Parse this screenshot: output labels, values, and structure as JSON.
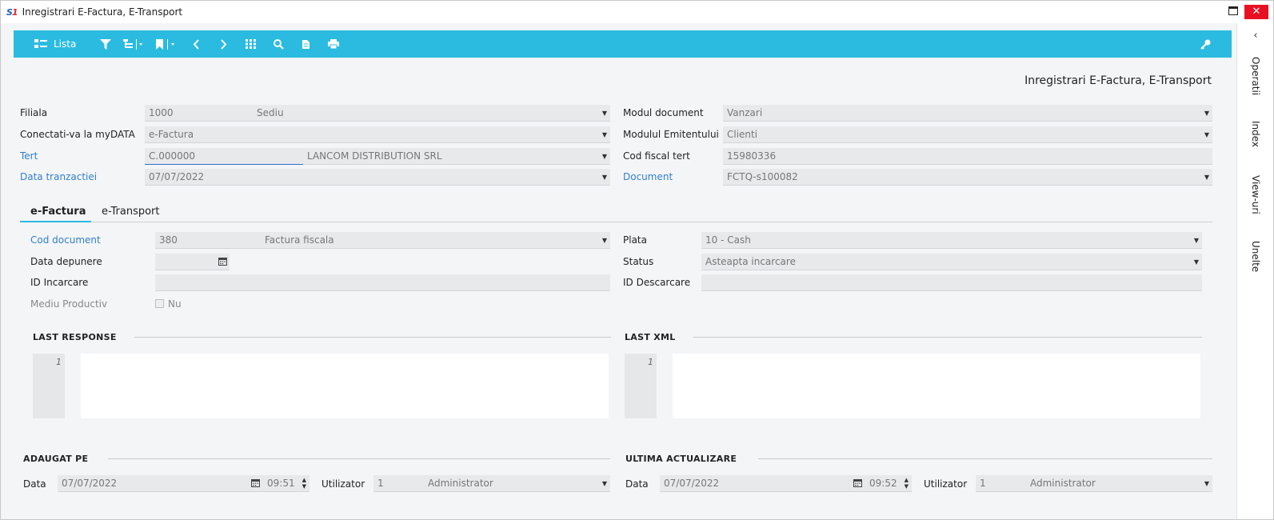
{
  "window": {
    "title": "Inregistrari E-Factura, E-Transport",
    "logo_text": "S",
    "logo_one": "1",
    "maximize_icon": "maximize-icon",
    "close_symbol": "✕"
  },
  "toolbar": {
    "lista_label": "Lista",
    "icons": [
      "list-icon",
      "filter-icon",
      "tree-icon",
      "bookmark-icon",
      "prev-icon",
      "next-icon",
      "grid-icon",
      "zoom-icon",
      "attach-icon",
      "print-icon",
      "key-icon"
    ]
  },
  "sidebar": {
    "collapse": "‹",
    "tabs": [
      "Operatii",
      "Index",
      "View-uri",
      "Unelte"
    ]
  },
  "page_title": "Inregistrari E-Factura, E-Transport",
  "header_left": {
    "filiala": {
      "label": "Filiala",
      "code": "1000",
      "name": "Sediu"
    },
    "conectati": {
      "label": "Conectati-va la myDATA",
      "value": "e-Factura"
    },
    "tert": {
      "label": "Tert",
      "code": "C.000000",
      "name": "LANCOM DISTRIBUTION SRL"
    },
    "data_tranzactiei": {
      "label": "Data tranzactiei",
      "value": "07/07/2022"
    }
  },
  "header_right": {
    "modul_document": {
      "label": "Modul document",
      "value": "Vanzari"
    },
    "modul_emitent": {
      "label": "Modulul Emitentului",
      "value": "Clienti"
    },
    "cod_fiscal": {
      "label": "Cod fiscal tert",
      "value": "15980336"
    },
    "document": {
      "label": "Document",
      "value": "FCTQ-s100082"
    }
  },
  "tabs": [
    "e-Factura",
    "e-Transport"
  ],
  "efactura": {
    "cod_document": {
      "label": "Cod document",
      "code": "380",
      "name": "Factura fiscala"
    },
    "data_depunere": {
      "label": "Data depunere",
      "value": ""
    },
    "id_incarcare": {
      "label": "ID Incarcare",
      "value": ""
    },
    "mediu_productiv": {
      "label": "Mediu Productiv",
      "value": "Nu"
    },
    "plata": {
      "label": "Plata",
      "value": "10 - Cash"
    },
    "status": {
      "label": "Status",
      "value": "Asteapta incarcare"
    },
    "id_descarcare": {
      "label": "ID Descarcare",
      "value": ""
    }
  },
  "last_response": {
    "title": "LAST RESPONSE",
    "line_no": "1"
  },
  "last_xml": {
    "title": "LAST XML",
    "line_no": "1"
  },
  "adaugat_pe": {
    "title": "ADAUGAT PE",
    "date_label": "Data",
    "date": "07/07/2022",
    "time": "09:51",
    "user_label": "Utilizator",
    "user_code": "1",
    "user_name": "Administrator"
  },
  "ultima_actualizare": {
    "title": "ULTIMA ACTUALIZARE",
    "date_label": "Data",
    "date": "07/07/2022",
    "time": "09:52",
    "user_label": "Utilizator",
    "user_code": "1",
    "user_name": "Administrator"
  },
  "colors": {
    "toolbar": "#2bbbe0",
    "link": "#2f7fd1",
    "close": "#e81123"
  }
}
